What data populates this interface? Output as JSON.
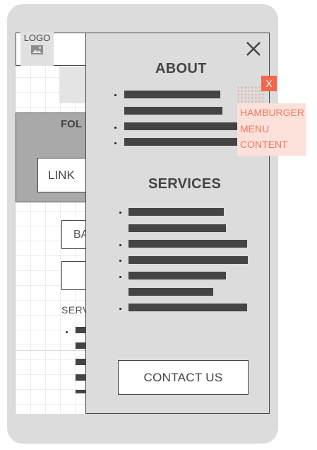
{
  "logo": {
    "label": "LOGO"
  },
  "background_page": {
    "follow_title": "FOL",
    "link_label": "LINK",
    "button_label": "BA",
    "services_label": "SERV"
  },
  "menu": {
    "sections": [
      {
        "title": "ABOUT",
        "items": [
          "",
          "",
          ""
        ]
      },
      {
        "title": "SERVICES",
        "items": [
          "",
          "",
          "",
          "",
          ""
        ]
      }
    ],
    "contact_label": "CONTACT US"
  },
  "annotation": {
    "marker": "X",
    "lines": [
      "HAMBURGER",
      "MENU",
      "CONTENT"
    ]
  },
  "colors": {
    "device": "#dcdcdc",
    "panel": "#dcdcdc",
    "placeholder_bar": "#444444",
    "annotation_accent": "#f0684d",
    "annotation_bg": "#fce0da"
  },
  "icons": [
    "image-placeholder-icon",
    "close-icon"
  ]
}
